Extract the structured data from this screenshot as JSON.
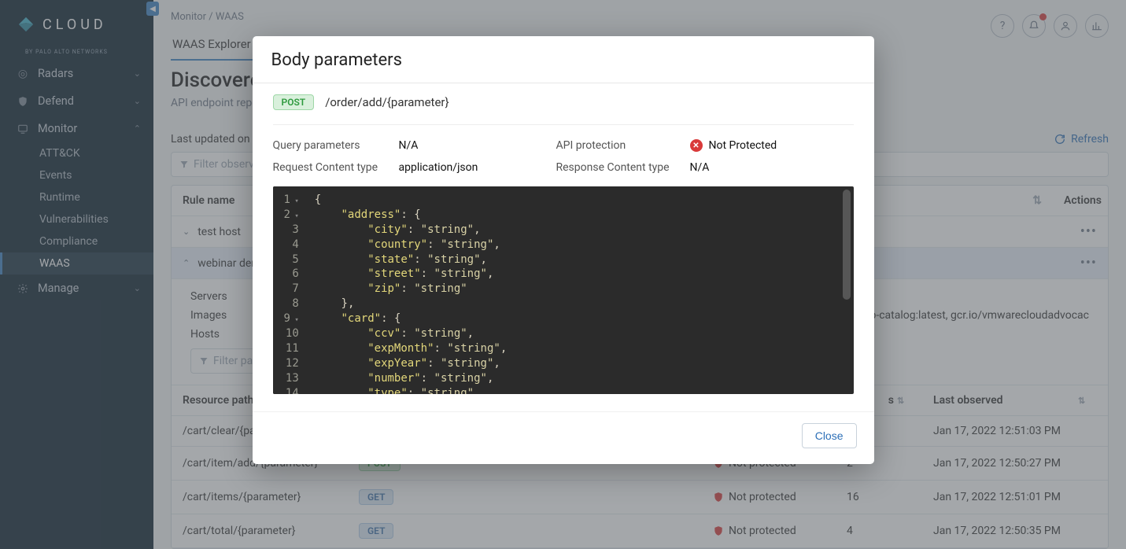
{
  "brand": {
    "name": "CLOUD",
    "byline": "BY PALO ALTO NETWORKS"
  },
  "topbar": {
    "help": "?",
    "bell": "bell",
    "user": "user",
    "chart": "chart"
  },
  "nav": {
    "items": [
      {
        "label": "Radars",
        "icon": "target",
        "expandable": true
      },
      {
        "label": "Defend",
        "icon": "shield",
        "expandable": true
      },
      {
        "label": "Monitor",
        "icon": "monitor",
        "expandable": true,
        "open": true,
        "children": [
          {
            "label": "ATT&CK"
          },
          {
            "label": "Events"
          },
          {
            "label": "Runtime"
          },
          {
            "label": "Vulnerabilities"
          },
          {
            "label": "Compliance"
          },
          {
            "label": "WAAS",
            "active": true
          }
        ]
      },
      {
        "label": "Manage",
        "icon": "gear",
        "expandable": true
      }
    ]
  },
  "breadcrumb": "Monitor / WAAS",
  "tab_label": "WAAS Explorer",
  "page_title": "Discovered",
  "page_subtitle": "API endpoint report",
  "last_updated": "Last updated on Jan",
  "refresh_label": "Refresh",
  "filter_placeholder": "Filter observat",
  "table": {
    "header_rule": "Rule name",
    "header_actions": "Actions",
    "rows": [
      {
        "name": "test host"
      },
      {
        "name": "webinar demo",
        "highlight": true
      }
    ]
  },
  "details": {
    "servers_label": "Servers",
    "images_label": "Images",
    "images_value": "acy/acmeshop-catalog:latest, gcr.io/vmwarecloudadvocac",
    "hosts_label": "Hosts",
    "filter_placeholder": "Filter path"
  },
  "inner_table": {
    "headers": {
      "path": "Resource path",
      "hits": "s",
      "last": "Last observed"
    },
    "rows": [
      {
        "path": "/cart/clear/{pa",
        "method": "",
        "protected": "",
        "hits": "",
        "last": "Jan 17, 2022 12:51:03 PM"
      },
      {
        "path": "/cart/item/add/{parameter}",
        "method": "POST",
        "protected": "Not protected",
        "hits": "2",
        "last": "Jan 17, 2022 12:50:27 PM"
      },
      {
        "path": "/cart/items/{parameter}",
        "method": "GET",
        "protected": "Not protected",
        "hits": "16",
        "last": "Jan 17, 2022 12:51:01 PM"
      },
      {
        "path": "/cart/total/{parameter}",
        "method": "GET",
        "protected": "Not protected",
        "hits": "4",
        "last": "Jan 17, 2022 12:50:35 PM"
      }
    ]
  },
  "modal": {
    "title": "Body parameters",
    "method": "POST",
    "path": "/order/add/{parameter}",
    "query_label": "Query parameters",
    "query_value": "N/A",
    "reqct_label": "Request Content type",
    "reqct_value": "application/json",
    "apiprot_label": "API protection",
    "apiprot_value": "Not Protected",
    "respct_label": "Response Content type",
    "respct_value": "N/A",
    "close_label": "Close",
    "code_lines": [
      "{",
      "    \"address\": {",
      "        \"city\": \"string\",",
      "        \"country\": \"string\",",
      "        \"state\": \"string\",",
      "        \"street\": \"string\",",
      "        \"zip\": \"string\"",
      "    },",
      "    \"card\": {",
      "        \"ccv\": \"string\",",
      "        \"expMonth\": \"string\",",
      "        \"expYear\": \"string\",",
      "        \"number\": \"string\",",
      "        \"type\": \"string\""
    ],
    "fold_lines": [
      1,
      2,
      9
    ]
  }
}
